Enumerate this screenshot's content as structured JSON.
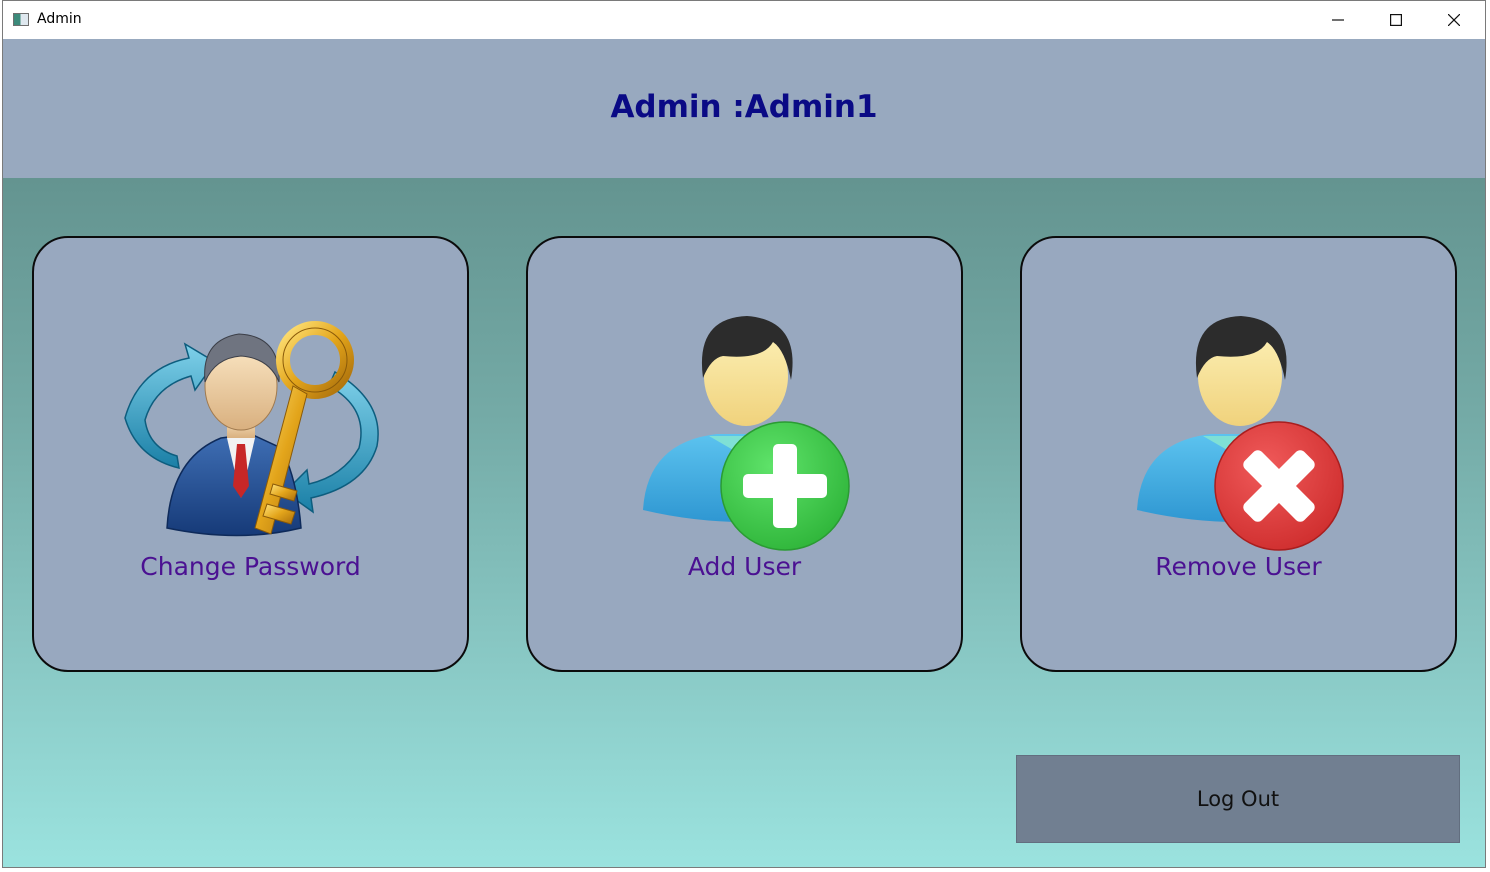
{
  "window": {
    "title": "Admin",
    "icon": "app-icon"
  },
  "titlebar": {
    "minimize_icon": "minimize-icon",
    "maximize_icon": "maximize-icon",
    "close_icon": "close-icon"
  },
  "header": {
    "title": "Admin :Admin1",
    "color": "#0a0a85",
    "background": "#98a9bf"
  },
  "cards": [
    {
      "label": "Change Password",
      "icon": "user-key-refresh-icon"
    },
    {
      "label": "Add User",
      "icon": "user-add-icon"
    },
    {
      "label": "Remove User",
      "icon": "user-remove-icon"
    }
  ],
  "logout": {
    "label": "Log Out"
  },
  "colors": {
    "card_background": "#98a8bf",
    "card_label": "#4b1192",
    "logout_background": "#717f91",
    "add_green": "#3cc944",
    "remove_red": "#e13c3c"
  }
}
